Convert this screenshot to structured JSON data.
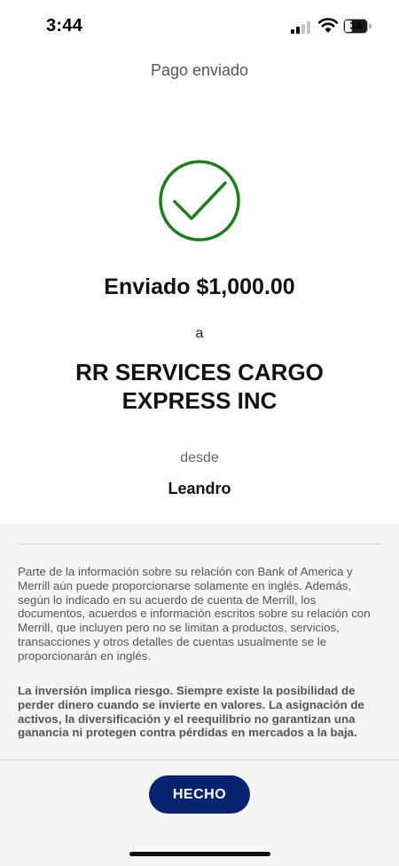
{
  "status_bar": {
    "time": "3:44",
    "battery_level": "34",
    "battery_fraction": 0.34,
    "signal_bars_active": 2,
    "signal_bars_total": 4,
    "icons": [
      "signal-icon",
      "wifi-icon",
      "battery-icon"
    ]
  },
  "header": {
    "title": "Pago enviado"
  },
  "confirmation": {
    "icon": "checkmark-circle-icon",
    "success_color": "#1e7e1e",
    "sent_text": "Enviado $1,000.00",
    "to_label": "a",
    "recipient": "RR SERVICES CARGO EXPRESS INC",
    "from_label": "desde",
    "sender": "Leandro"
  },
  "disclaimer": {
    "language_notice": "Parte de la información sobre su relación con Bank of America y Merrill aún puede proporcionarse solamente en inglés. Además, según lo indicado en su acuerdo de cuenta de Merrill, los documentos, acuerdos e información escritos sobre su relación con Merrill, que incluyen pero no se limitan a productos, servicios, transacciones y otros detalles de cuentas usualmente se le proporcionarán en inglés.",
    "risk_notice": "La inversión implica riesgo. Siempre existe la posibilidad de perder dinero cuando se invierte en valores. La asignación de activos, la diversificación y el reequilibrio no garantizan una ganancia ni protegen contra pérdidas en mercados a la baja."
  },
  "footer": {
    "done_label": "HECHO",
    "button_color": "#0a2370"
  }
}
